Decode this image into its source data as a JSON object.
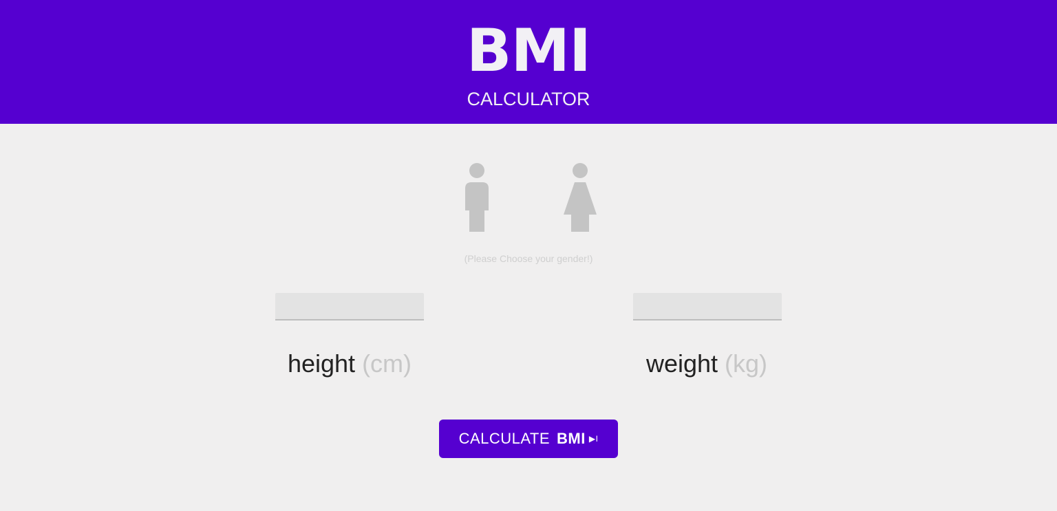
{
  "header": {
    "title": "BMI",
    "subtitle": "CALCULATOR",
    "background": "#5500d0"
  },
  "gender": {
    "icons": [
      "male-icon",
      "female-icon"
    ],
    "hint": "(Please Choose your gender!)",
    "icon_color": "#c4c4c4"
  },
  "height": {
    "label": "height",
    "unit": "(cm)",
    "value": ""
  },
  "weight": {
    "label": "weight",
    "unit": "(kg)",
    "value": ""
  },
  "button": {
    "label_main": "CALCULATE",
    "label_bold": "BMI",
    "label_arrow": "▶I",
    "color": "#5500d0"
  }
}
